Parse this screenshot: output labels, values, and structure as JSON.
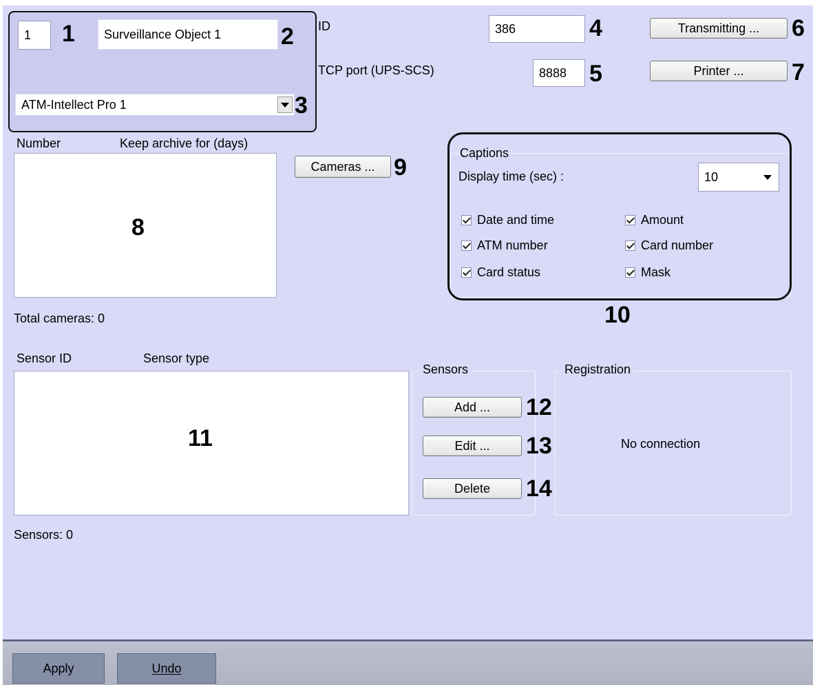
{
  "top_left": {
    "number_value": "1",
    "name_value": "Surveillance Object 1",
    "parent_select": "ATM-Intellect Pro 1"
  },
  "id_field": {
    "label": "ID",
    "value": "386"
  },
  "port_field": {
    "label": "TCP port (UPS-SCS)",
    "value": "8888"
  },
  "buttons": {
    "transmitting": "Transmitting ...",
    "printer": "Printer ...",
    "cameras": "Cameras ...",
    "add": "Add ...",
    "edit": "Edit ...",
    "delete": "Delete"
  },
  "cameras_list": {
    "columns": [
      "Number",
      "Keep archive for (days)"
    ],
    "total": "Total cameras: 0"
  },
  "captions": {
    "title": "Captions",
    "display_time_label": "Display time (sec) :",
    "display_time_value": "10",
    "checkboxes": [
      "Date and time",
      "Amount",
      "ATM number",
      "Card number",
      "Card status",
      "Mask"
    ]
  },
  "sensors_list": {
    "columns": [
      "Sensor ID",
      "Sensor type"
    ],
    "total": "Sensors: 0"
  },
  "sensors_group": {
    "title": "Sensors"
  },
  "registration": {
    "title": "Registration",
    "status": "No connection"
  },
  "callouts": [
    "1",
    "2",
    "3",
    "4",
    "5",
    "6",
    "7",
    "8",
    "9",
    "10",
    "11",
    "12",
    "13",
    "14"
  ],
  "bottom": {
    "apply": "Apply",
    "undo": "Undo"
  }
}
